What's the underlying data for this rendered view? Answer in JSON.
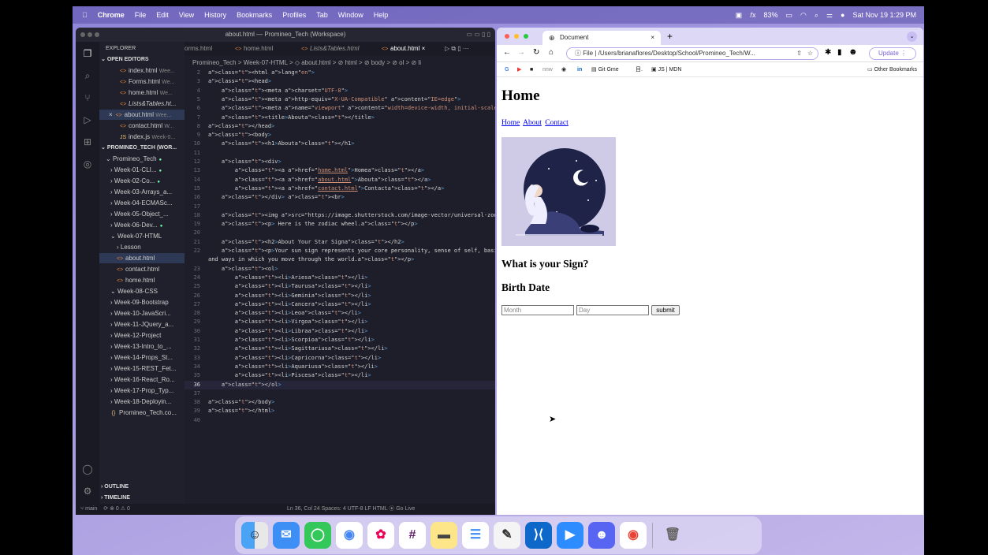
{
  "menubar": {
    "app": "Chrome",
    "items": [
      "File",
      "Edit",
      "View",
      "History",
      "Bookmarks",
      "Profiles",
      "Tab",
      "Window",
      "Help"
    ],
    "battery": "83%",
    "datetime": "Sat Nov 19  1:29 PM"
  },
  "vscode": {
    "window_title": "about.html — Promineo_Tech (Workspace)",
    "explorer_label": "EXPLORER",
    "open_editors_label": "OPEN EDITORS",
    "open_editors": [
      {
        "name": "index.html",
        "path": "Wee..."
      },
      {
        "name": "Forms.html",
        "path": "We..."
      },
      {
        "name": "home.html",
        "path": "We..."
      },
      {
        "name": "Lists&Tables.ht...",
        "path": ""
      },
      {
        "name": "about.html",
        "path": "Wee..."
      },
      {
        "name": "contact.html",
        "path": "W..."
      },
      {
        "name": "index.js",
        "path": "Week-0..."
      }
    ],
    "workspace_label": "PROMINEO_TECH (WOR...",
    "folders": [
      "Promineo_Tech",
      "Week-01-CLI...",
      "Week-02-Co...",
      "Week-03-Arrays_a...",
      "Week-04-ECMASc...",
      "Week-05-Object_...",
      "Week-06-Dev...",
      "Week-07-HTML"
    ],
    "week7_children": [
      "Lesson",
      "about.html",
      "contact.html",
      "home.html"
    ],
    "more_folders": [
      "Week-08-CSS",
      "Week-09-Bootstrap",
      "Week-10-JavaScri...",
      "Week-11-JQuery_a...",
      "Week-12-Project",
      "Week-13-Intro_to_...",
      "Week-14-Props_St...",
      "Week-15-REST_Fet...",
      "Week-16-React_Ro...",
      "Week-17-Prop_Typ...",
      "Week-18-Deployin...",
      "Promineo_Tech.co..."
    ],
    "outline_label": "OUTLINE",
    "timeline_label": "TIMELINE",
    "tabs": [
      "orms.html",
      "home.html",
      "Lists&Tables.html",
      "about.html"
    ],
    "breadcrumb": "Promineo_Tech > Week-07-HTML > ◇ about.html > ⊘ html > ⊘ body > ⊘ ol > ⊘ li",
    "status_branch": "main",
    "status_left": "⟳  ⊗ 0 ⚠ 0",
    "status_right": "Ln 36, Col 24   Spaces: 4   UTF-8   LF   HTML   ⦿ Go Live",
    "code_lines": [
      {
        "n": "2",
        "c": "<html lang=\"en\">"
      },
      {
        "n": "3",
        "c": "<head>"
      },
      {
        "n": "4",
        "c": "    <meta charset=\"UTF-8\">"
      },
      {
        "n": "5",
        "c": "    <meta http-equiv=\"X-UA-Compatible\" content=\"IE=edge\">"
      },
      {
        "n": "6",
        "c": "    <meta name=\"viewport\" content=\"width=device-width, initial-scale=1.0\">"
      },
      {
        "n": "7",
        "c": "    <title>About</title>"
      },
      {
        "n": "8",
        "c": "</head>"
      },
      {
        "n": "9",
        "c": "<body>"
      },
      {
        "n": "10",
        "c": "    <h1>About</h1>"
      },
      {
        "n": "11",
        "c": ""
      },
      {
        "n": "12",
        "c": "    <div>"
      },
      {
        "n": "13",
        "c": "        <a href=\"home.html\">Home</a>"
      },
      {
        "n": "14",
        "c": "        <a href=\"about.html\">About</a>"
      },
      {
        "n": "15",
        "c": "        <a href=\"contact.html\">Contact</a>"
      },
      {
        "n": "16",
        "c": "    </div> <br>"
      },
      {
        "n": "17",
        "c": ""
      },
      {
        "n": "18",
        "c": "    <img src=\"https://image.shutterstock.com/image-vector/universal-zodiac-whe"
      },
      {
        "n": "19",
        "c": "    <p> Here is the zodiac wheel.</p>"
      },
      {
        "n": "20",
        "c": ""
      },
      {
        "n": "21",
        "c": "    <h2>About Your Star Sign</h2>"
      },
      {
        "n": "22",
        "c": "    <p>Your sun sign represents your core personality, sense of self, basic pr"
      },
      {
        "n": "",
        "c": "and ways in which you move through the world.</p>"
      },
      {
        "n": "23",
        "c": "    <ol>"
      },
      {
        "n": "24",
        "c": "        <li>Aries</li>"
      },
      {
        "n": "25",
        "c": "        <li>Taurus</li>"
      },
      {
        "n": "26",
        "c": "        <li>Gemini</li>"
      },
      {
        "n": "27",
        "c": "        <li>Cancer</li>"
      },
      {
        "n": "28",
        "c": "        <li>Leo</li>"
      },
      {
        "n": "29",
        "c": "        <li>Virgo</li>"
      },
      {
        "n": "30",
        "c": "        <li>Libra</li>"
      },
      {
        "n": "31",
        "c": "        <li>Scorpio</li>"
      },
      {
        "n": "32",
        "c": "        <li>Sagittarius</li>"
      },
      {
        "n": "33",
        "c": "        <li>Capricorn</li>"
      },
      {
        "n": "34",
        "c": "        <li>Aquarius</li>"
      },
      {
        "n": "35",
        "c": "        <li>Pisces</li>"
      },
      {
        "n": "36",
        "c": "    </ol>"
      },
      {
        "n": "37",
        "c": ""
      },
      {
        "n": "38",
        "c": "</body>"
      },
      {
        "n": "39",
        "c": "</html>"
      },
      {
        "n": "40",
        "c": ""
      }
    ]
  },
  "chrome": {
    "tab_title": "Document",
    "url": "File  |  /Users/brianaflores/Desktop/School/Promineo_Tech/W...",
    "update_label": "Update",
    "bookmarks": [
      "Git Gme",
      "JS | MDN"
    ],
    "other_bookmarks": "Other Bookmarks",
    "page": {
      "heading": "Home",
      "nav": [
        "Home",
        "About",
        "Contact"
      ],
      "question": "What is your Sign?",
      "birth_date": "Birth Date",
      "month_placeholder": "Month",
      "day_placeholder": "Day",
      "submit": "submit"
    }
  },
  "colors": {
    "accent": "#b8a9ef",
    "editor_bg": "#1e1e2a",
    "link": "#0000ee"
  }
}
